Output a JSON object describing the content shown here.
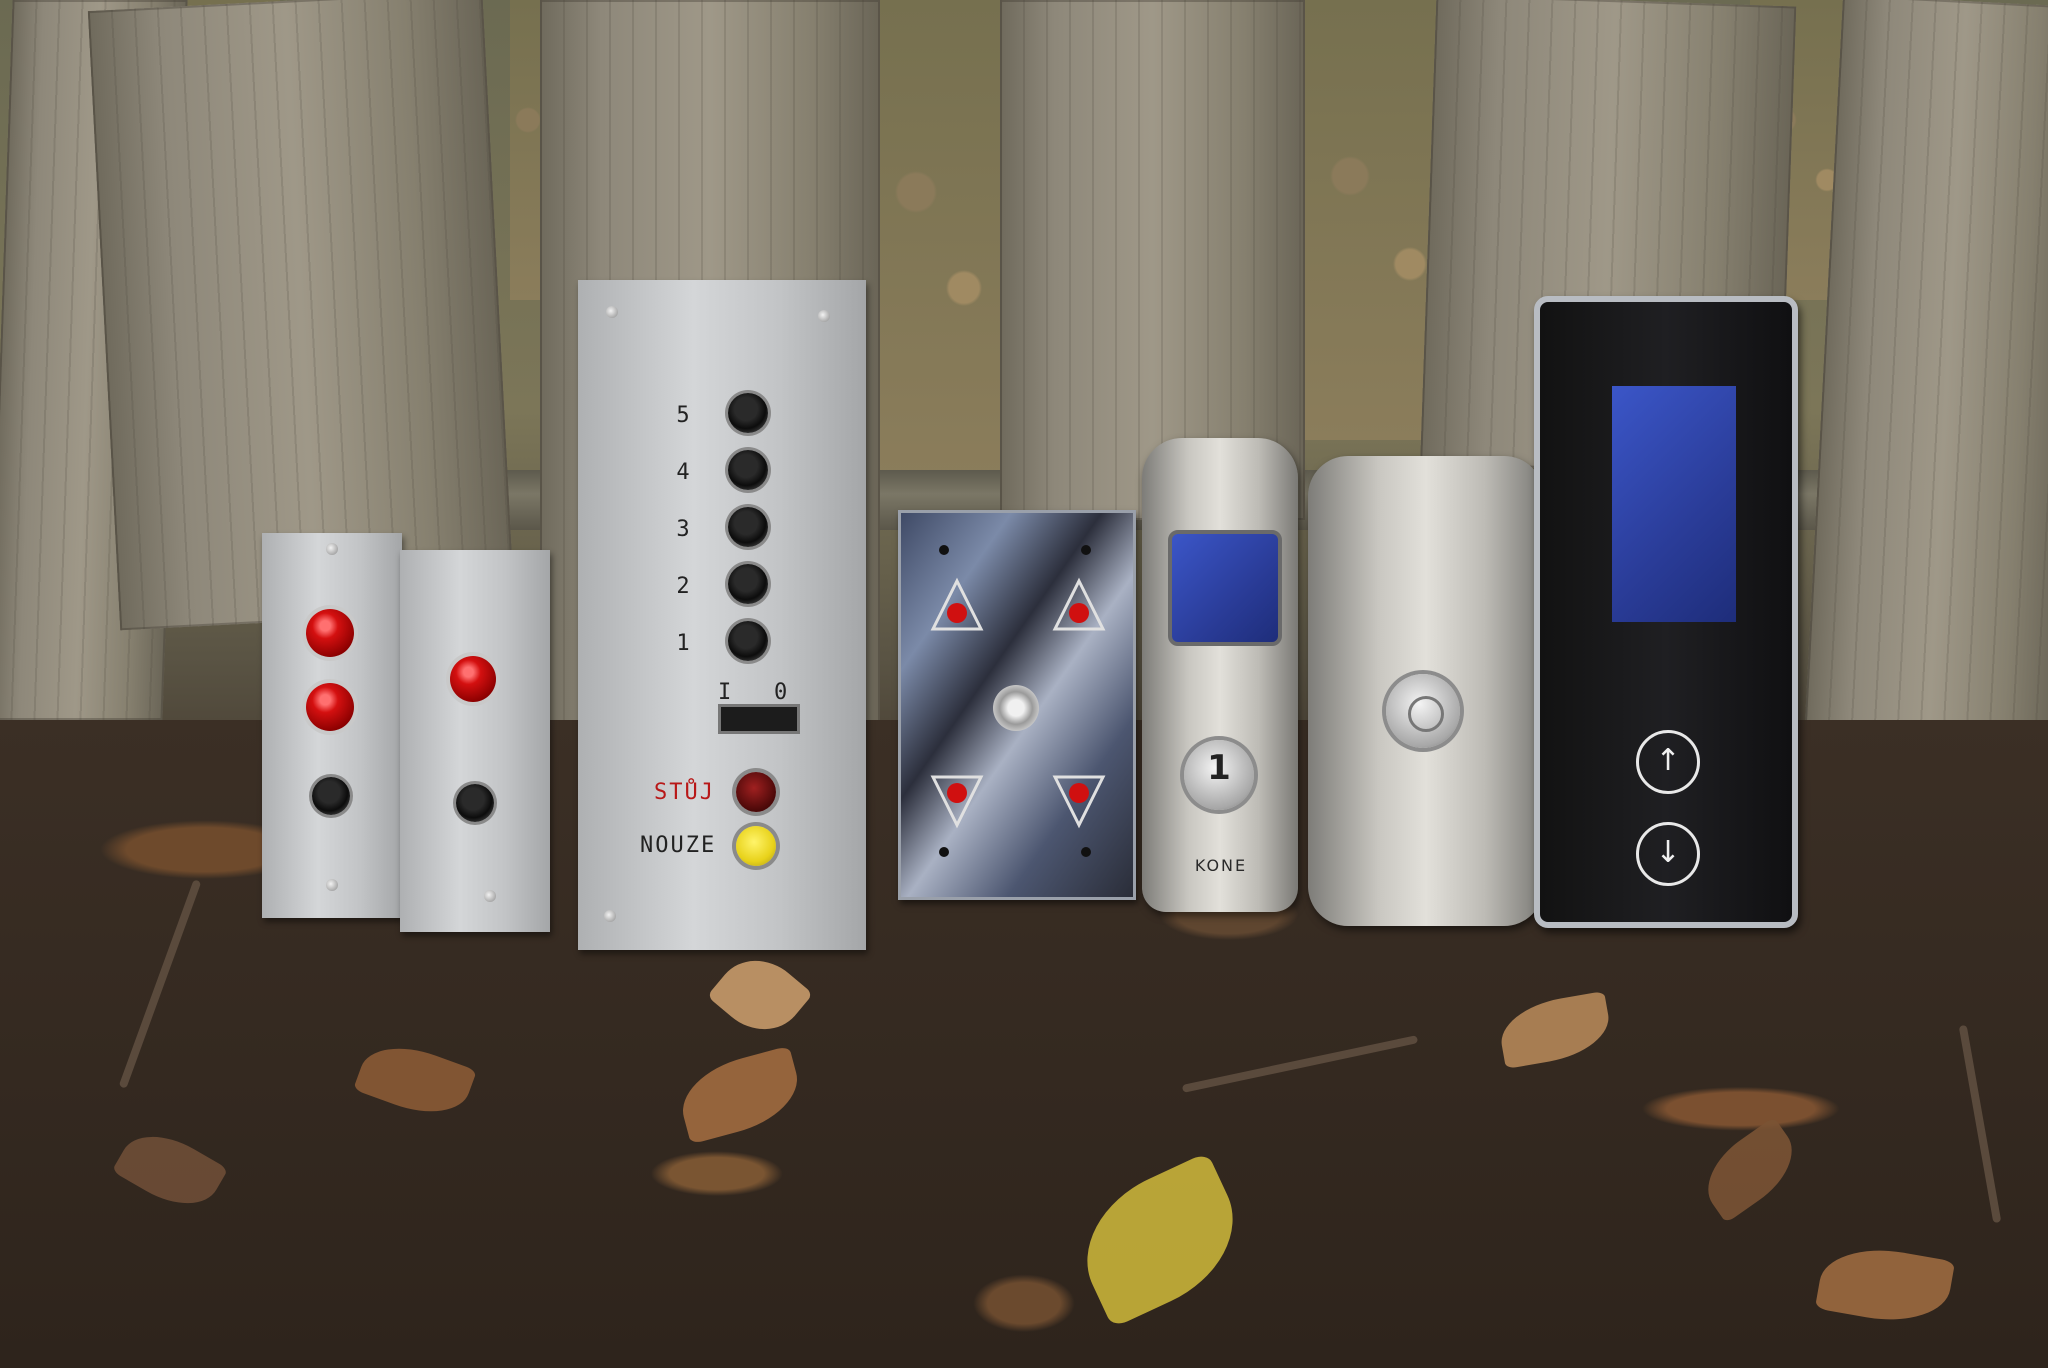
{
  "scene": {
    "colors": {
      "fence_wood": "#9f9888",
      "ground": "#3a2e24",
      "panel_red_lamp": "#d41010",
      "lcd_blue": "#2a3c98",
      "yellow_button": "#e8d21a"
    }
  },
  "panel_five_floor": {
    "floors": [
      "5",
      "4",
      "3",
      "2",
      "1"
    ],
    "switch_left": "I",
    "switch_right": "0",
    "stop_label": "STŮJ",
    "emergency_label": "NOUZE"
  },
  "panel_oval_steel": {
    "floor_button": "1",
    "brand": "KONE"
  },
  "panel_touch": {
    "up_arrow": "↑",
    "down_arrow": "↓"
  }
}
